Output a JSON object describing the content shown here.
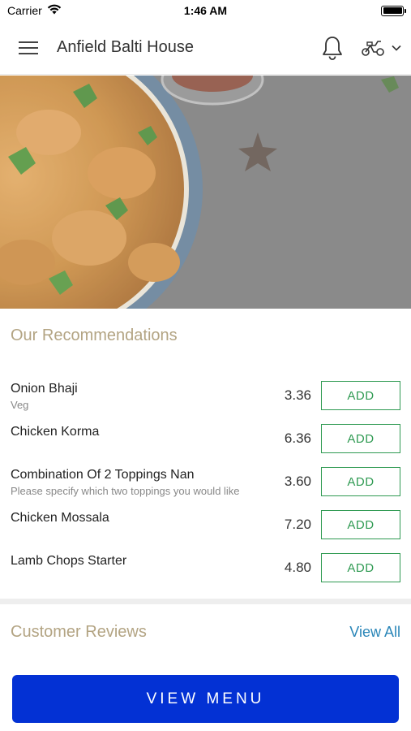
{
  "status_bar": {
    "carrier": "Carrier",
    "time": "1:46 AM"
  },
  "header": {
    "title": "Anfield Balti House",
    "icons": [
      "hamburger-menu-icon",
      "bell-icon",
      "scooter-icon",
      "chevron-down-icon"
    ]
  },
  "recommendations": {
    "title": "Our Recommendations",
    "add_label": "ADD",
    "items": [
      {
        "name": "Onion Bhaji",
        "desc": "Veg",
        "price": "3.36"
      },
      {
        "name": "Chicken Korma",
        "desc": "",
        "price": "6.36"
      },
      {
        "name": "Combination Of 2 Toppings Nan",
        "desc": "Please specify which two toppings you would like",
        "price": "3.60"
      },
      {
        "name": "Chicken Mossala",
        "desc": "",
        "price": "7.20"
      },
      {
        "name": "Lamb Chops Starter",
        "desc": "",
        "price": "4.80"
      }
    ]
  },
  "reviews": {
    "title": "Customer Reviews",
    "view_all": "View All"
  },
  "cta": {
    "label": "VIEW MENU"
  },
  "colors": {
    "accent_gold": "#b3a483",
    "add_green": "#2f9a52",
    "link_blue": "#2a86b8",
    "cta_blue": "#0331d4"
  }
}
